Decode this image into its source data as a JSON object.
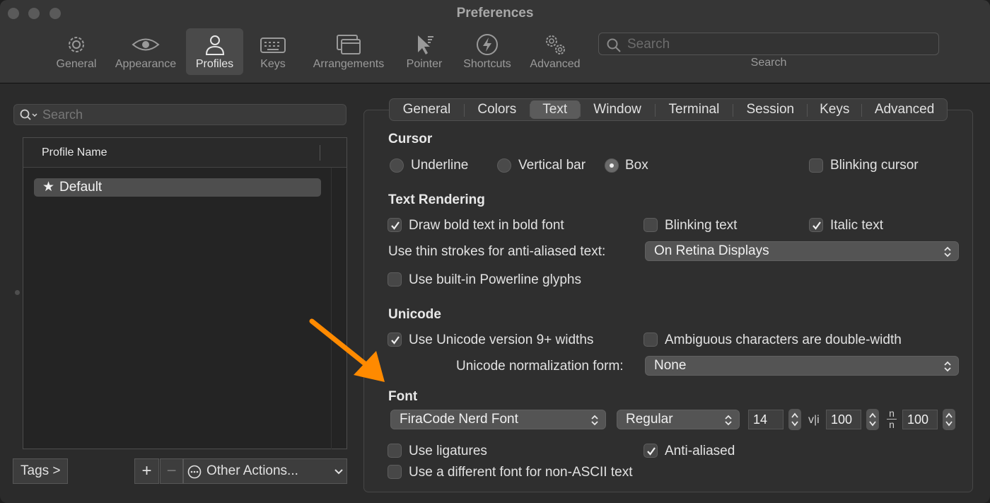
{
  "window": {
    "title": "Preferences"
  },
  "toolbar": {
    "items": [
      {
        "label": "General",
        "icon": "gear-icon"
      },
      {
        "label": "Appearance",
        "icon": "eye-icon"
      },
      {
        "label": "Profiles",
        "icon": "person-icon",
        "active": true
      },
      {
        "label": "Keys",
        "icon": "keyboard-icon"
      },
      {
        "label": "Arrangements",
        "icon": "windows-icon"
      },
      {
        "label": "Pointer",
        "icon": "pointer-icon"
      },
      {
        "label": "Shortcuts",
        "icon": "bolt-icon"
      },
      {
        "label": "Advanced",
        "icon": "gears-icon"
      }
    ],
    "search_placeholder": "Search",
    "search_label": "Search"
  },
  "left": {
    "search_placeholder": "Search",
    "column_header": "Profile Name",
    "profiles": [
      {
        "name": "Default",
        "default": true
      }
    ],
    "tags_button": "Tags >",
    "add_button": "+",
    "remove_button": "−",
    "actions_button": "Other Actions..."
  },
  "tabs": {
    "items": [
      "General",
      "Colors",
      "Text",
      "Window",
      "Terminal",
      "Session",
      "Keys",
      "Advanced"
    ],
    "active": "Text"
  },
  "cursor": {
    "heading": "Cursor",
    "options": [
      "Underline",
      "Vertical bar",
      "Box"
    ],
    "selected": "Box",
    "blinking_label": "Blinking cursor",
    "blinking": false
  },
  "rendering": {
    "heading": "Text Rendering",
    "bold_label": "Draw bold text in bold font",
    "bold": true,
    "blink_text_label": "Blinking text",
    "blink_text": false,
    "italic_label": "Italic text",
    "italic": true,
    "thin_label": "Use thin strokes for anti-aliased text:",
    "thin_value": "On Retina Displays",
    "powerline_label": "Use built-in Powerline glyphs",
    "powerline": false
  },
  "unicode": {
    "heading": "Unicode",
    "widths_label": "Use Unicode version 9+ widths",
    "widths": true,
    "ambiguous_label": "Ambiguous characters are double-width",
    "ambiguous": false,
    "norm_label": "Unicode normalization form:",
    "norm_value": "None"
  },
  "font": {
    "heading": "Font",
    "family": "FiraCode Nerd Font",
    "style": "Regular",
    "size": "14",
    "h_spacing_glyph": "v|i",
    "h_spacing": "100",
    "v_spacing_glyph_top": "n",
    "v_spacing_glyph_bottom": "n",
    "v_spacing": "100",
    "ligatures_label": "Use ligatures",
    "ligatures": false,
    "antialias_label": "Anti-aliased",
    "antialias": true,
    "nonascii_label": "Use a different font for non-ASCII text",
    "nonascii": false
  },
  "colors": {
    "accent_arrow": "#ff8a00",
    "background": "#2b2b2b"
  }
}
